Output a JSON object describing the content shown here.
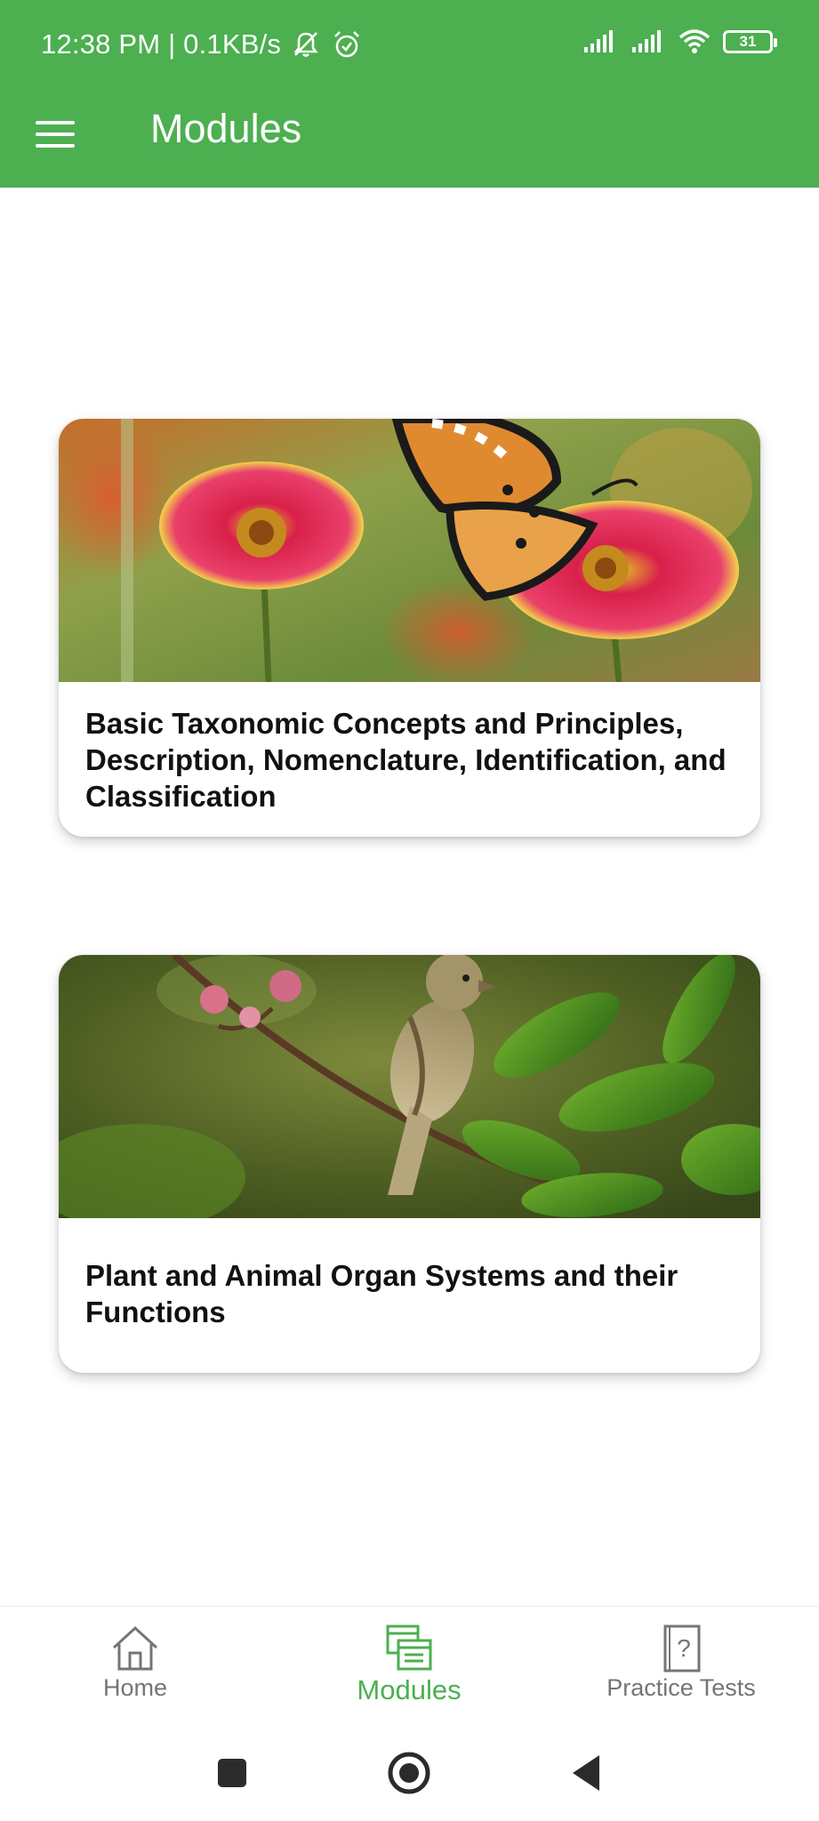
{
  "status_bar": {
    "time_speed": "12:38 PM | 0.1KB/s",
    "battery": "31",
    "icons": [
      "mute-bell-icon",
      "alarm-icon",
      "signal-icon",
      "signal-icon",
      "wifi-icon",
      "battery-icon"
    ]
  },
  "app_bar": {
    "menu_icon": "hamburger-menu-icon",
    "title": "Modules"
  },
  "modules": [
    {
      "title": "Basic Taxonomic Concepts and Principles, Description, Nomenclature, Identification, and Classification",
      "image": "butterfly-on-red-flower-photo"
    },
    {
      "title": "Plant and Animal Organ Systems and their Functions",
      "image": "sparrow-on-blossom-branch-photo"
    }
  ],
  "bottom_nav": {
    "items": [
      {
        "label": "Home",
        "icon": "home-icon",
        "active": false
      },
      {
        "label": "Modules",
        "icon": "modules-icon",
        "active": true
      },
      {
        "label": "Practice Tests",
        "icon": "practice-tests-icon",
        "active": false
      }
    ]
  },
  "colors": {
    "primary": "#4caf50",
    "nav_inactive": "#757575",
    "text": "#111111"
  }
}
